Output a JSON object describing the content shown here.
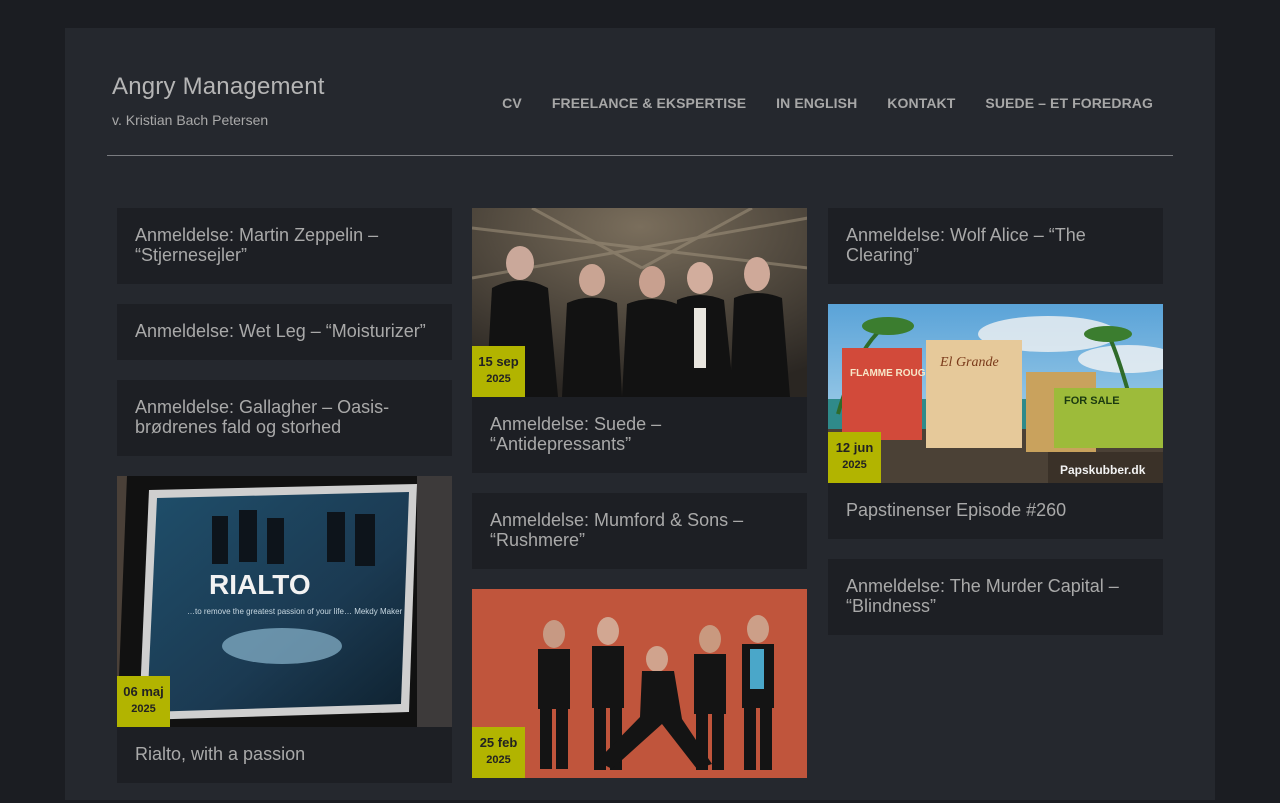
{
  "site": {
    "title": "Angry Management",
    "description": "v. Kristian Bach Petersen"
  },
  "nav": [
    {
      "label": "CV"
    },
    {
      "label": "FREELANCE & EKSPERTISE"
    },
    {
      "label": "IN ENGLISH"
    },
    {
      "label": "KONTAKT"
    },
    {
      "label": "SUEDE – ET FOREDRAG"
    }
  ],
  "columns": [
    [
      {
        "title": "Anmeldelse: Martin Zeppelin – “Stjernesejler”"
      },
      {
        "title": "Anmeldelse: Wet Leg – “Moisturizer”"
      },
      {
        "title": "Anmeldelse: Gallagher – Oasis-brødrenes fald og storhed"
      },
      {
        "title": "Rialto, with a passion",
        "date_day": "06 maj",
        "date_year": "2025",
        "image_text": "RIALTO",
        "image_caption": "…to remove the greatest passion of your life…  Mekdy Maker"
      }
    ],
    [
      {
        "title": "Anmeldelse: Suede – “Antidepressants”",
        "date_day": "15 sep",
        "date_year": "2025"
      },
      {
        "title": "Anmeldelse: Mumford & Sons – “Rushmere”"
      },
      {
        "title": "",
        "date_day": "25 feb",
        "date_year": "2025"
      }
    ],
    [
      {
        "title": "Anmeldelse: Wolf Alice – “The Clearing”"
      },
      {
        "title": "Papstinenser Episode #260",
        "date_day": "12 jun",
        "date_year": "2025",
        "image_labels": [
          "FLAMME ROUGE",
          "El Grande",
          "FOR SALE",
          "Papskubber.dk"
        ]
      },
      {
        "title": "Anmeldelse: The Murder Capital – “Blindness”"
      }
    ]
  ],
  "colors": {
    "background": "#1b1d22",
    "page": "#25282e",
    "card": "#1d1f24",
    "date_badge": "#b2b400"
  }
}
